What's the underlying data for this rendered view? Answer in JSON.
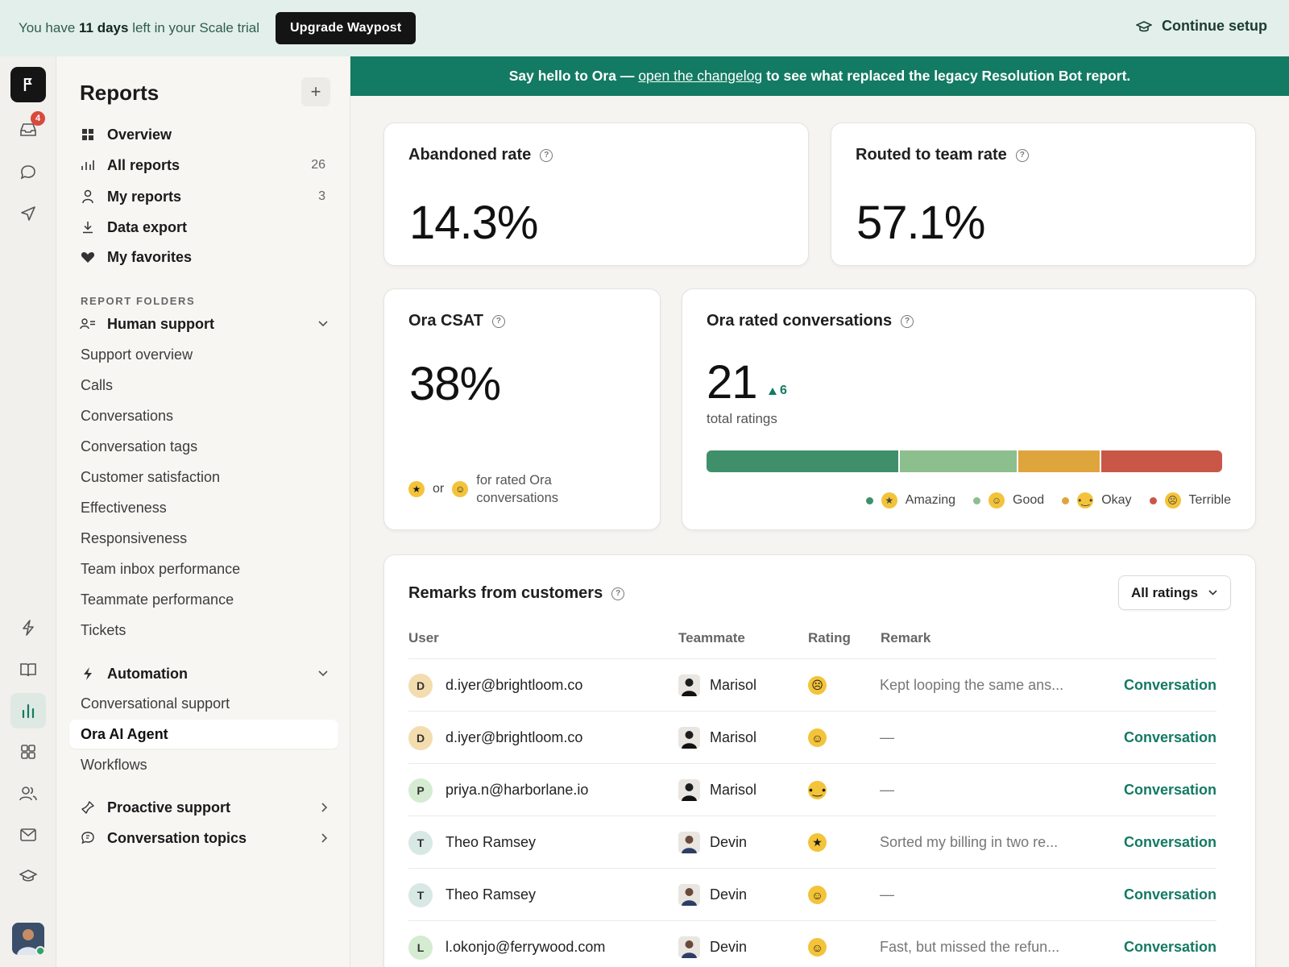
{
  "trial": {
    "prefix": "You have",
    "days": "11 days",
    "suffix": "left in your Scale trial",
    "upgrade_label": "Upgrade Waypost",
    "continue_label": "Continue setup"
  },
  "rail": {
    "inbox_badge": "4"
  },
  "sidebar": {
    "title": "Reports",
    "add_label": "+",
    "nav": [
      {
        "label": "Overview",
        "count": ""
      },
      {
        "label": "All reports",
        "count": "26"
      },
      {
        "label": "My reports",
        "count": "3"
      },
      {
        "label": "Data export",
        "count": ""
      },
      {
        "label": "My favorites",
        "count": ""
      }
    ],
    "folders_label": "REPORT FOLDERS",
    "human_support": {
      "label": "Human support",
      "items": [
        "Support overview",
        "Calls",
        "Conversations",
        "Conversation tags",
        "Customer satisfaction",
        "Effectiveness",
        "Responsiveness",
        "Team inbox performance",
        "Teammate performance",
        "Tickets"
      ]
    },
    "automation": {
      "label": "Automation",
      "items": [
        "Conversational support",
        "Ora AI Agent",
        "Workflows"
      ]
    },
    "proactive_label": "Proactive support",
    "topics_label": "Conversation topics"
  },
  "banner": {
    "before": "Say hello to Ora —",
    "link": "open the changelog",
    "after": "to see what replaced the legacy Resolution Bot report."
  },
  "cards": {
    "abandoned": {
      "title": "Abandoned rate",
      "value": "14.3%"
    },
    "routed": {
      "title": "Routed to team rate",
      "value": "57.1%"
    },
    "csat": {
      "title": "Ora CSAT",
      "value": "38%",
      "or": "or",
      "note_line1": "for rated Ora",
      "note_line2": "conversations"
    },
    "rated": {
      "title": "Ora rated conversations",
      "value": "21",
      "delta": "6",
      "caption": "total ratings",
      "distribution": [
        {
          "name": "Amazing",
          "share": 0.375,
          "color": "#3f8f6b"
        },
        {
          "name": "Good",
          "share": 0.23,
          "color": "#8cbf8d"
        },
        {
          "name": "Okay",
          "share": 0.16,
          "color": "#dfa53d"
        },
        {
          "name": "Terrible",
          "share": 0.235,
          "color": "#c95748"
        }
      ]
    }
  },
  "remarks": {
    "title": "Remarks from customers",
    "filter_label": "All ratings",
    "headers": {
      "user": "User",
      "teammate": "Teammate",
      "rating": "Rating",
      "remark": "Remark"
    },
    "rows": [
      {
        "initial": "D",
        "avatar_color": "#f3dcae",
        "user": "d.iyer@brightloom.co",
        "teammate": "Marisol",
        "rating": "terrible",
        "remark": "Kept looping the same ans...",
        "link": "Conversation"
      },
      {
        "initial": "D",
        "avatar_color": "#f3dcae",
        "user": "d.iyer@brightloom.co",
        "teammate": "Marisol",
        "rating": "good",
        "remark": "—",
        "link": "Conversation"
      },
      {
        "initial": "P",
        "avatar_color": "#d6ecd2",
        "user": "priya.n@harborlane.io",
        "teammate": "Marisol",
        "rating": "okay",
        "remark": "—",
        "link": "Conversation"
      },
      {
        "initial": "T",
        "avatar_color": "#d8e8e4",
        "user": "Theo Ramsey",
        "teammate": "Devin",
        "rating": "amazing",
        "remark": "Sorted my billing in two re...",
        "link": "Conversation"
      },
      {
        "initial": "T",
        "avatar_color": "#d8e8e4",
        "user": "Theo Ramsey",
        "teammate": "Devin",
        "rating": "good",
        "remark": "—",
        "link": "Conversation"
      },
      {
        "initial": "L",
        "avatar_color": "#d6ecd2",
        "user": "l.okonjo@ferrywood.com",
        "teammate": "Devin",
        "rating": "good",
        "remark": "Fast, but missed the refun...",
        "link": "Conversation"
      }
    ]
  }
}
